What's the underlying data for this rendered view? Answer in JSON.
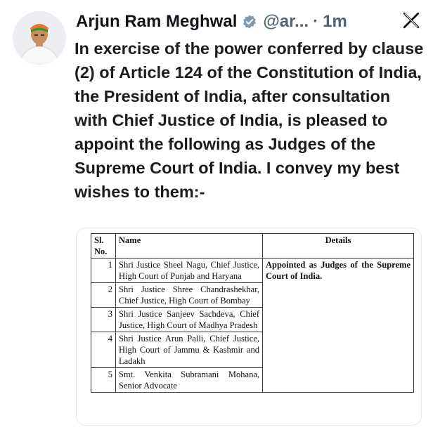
{
  "author": {
    "name": "Arjun Ram Meghwal",
    "handle": "@ar...",
    "separator": "·",
    "time": "1m"
  },
  "icons": {
    "verified": "verified-badge-icon",
    "platform": "x-logo-icon",
    "avatar": "profile-photo"
  },
  "colors": {
    "verified": "#829aab",
    "secondary_text": "#536471"
  },
  "tweet": {
    "text": "In exercise of the power conferred by clause (2) of Article 124 of the Constitution of India, the President of India, after consultation with Chief Justice of India, is pleased to appoint the following as Judges of the Supreme Court of India. I convey my best wishes to them:-"
  },
  "table": {
    "headers": {
      "sl": "Sl. No.",
      "name": "Name",
      "details": "Details"
    },
    "rows": [
      {
        "sl": "1",
        "name": "Shri Justice Sheel Nagu, Chief Justice, High Court of Punjab and Haryana"
      },
      {
        "sl": "2",
        "name": "Shri Justice Shree Chandrashekhar, Chief Justice, High Court of Bombay"
      },
      {
        "sl": "3",
        "name": "Shri Justice Sanjeev Sachdeva, Chief Justice, High Court of Madhya Pradesh"
      },
      {
        "sl": "4",
        "name": "Shri Justice Arun Palli, Chief Justice, High Court of Jammu & Kashmir and Ladakh"
      },
      {
        "sl": "5",
        "name": "Smt. Venkita Subramani Mohana, Senior Advocate"
      }
    ],
    "details": "Appointed as Judges of the Supreme Court of India."
  }
}
